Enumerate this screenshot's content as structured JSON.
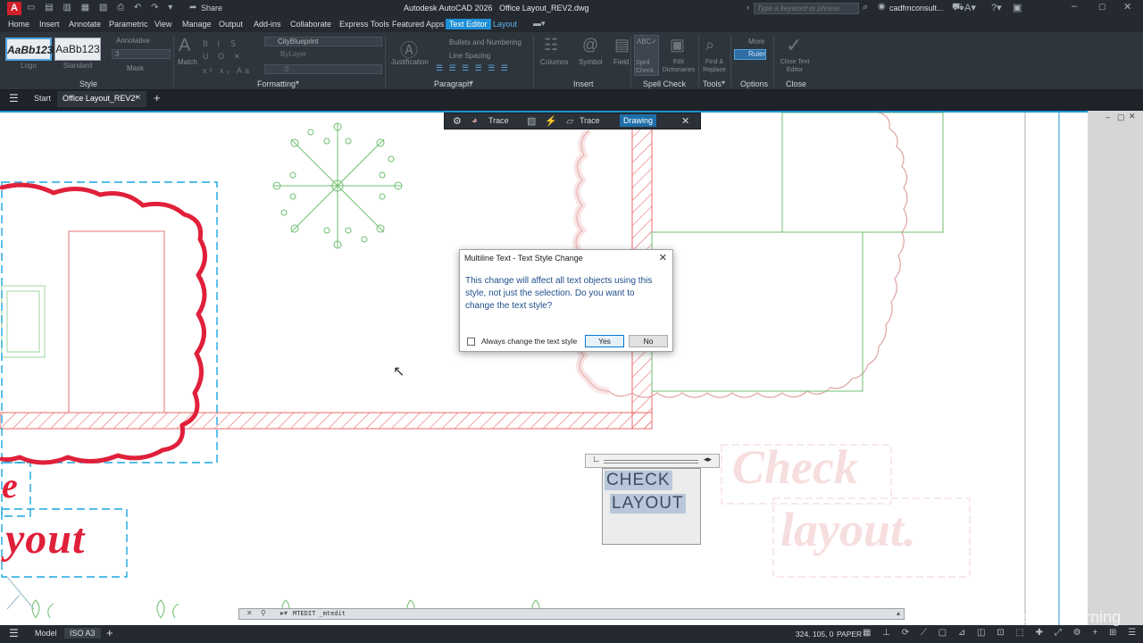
{
  "app": {
    "title": "Autodesk AutoCAD 2026   Office Layout_REV2.dwg",
    "search_placeholder": "Type a keyword or phrase",
    "user": "cadfmconsult...",
    "share_label": "Share",
    "logo_letter": "A"
  },
  "menu": {
    "items": [
      "Home",
      "Insert",
      "Annotate",
      "Parametric",
      "View",
      "Manage",
      "Output",
      "Add-ins",
      "Collaborate",
      "Express Tools",
      "Featured Apps",
      "Text Editor",
      "Layout"
    ],
    "active": "Text Editor"
  },
  "ribbon": {
    "style_swatches": [
      {
        "label": "AaBb123",
        "caption": "Logo"
      },
      {
        "label": "AaBb123",
        "caption": "Standard"
      }
    ],
    "annotative_label": "Annotative",
    "text_height_value": "3",
    "mask_label": "Mask",
    "match_label": "Match",
    "font_value": "CityBlueprint",
    "layer_value": "ByLayer",
    "color_value": "0",
    "justification_label": "Justification",
    "bullets_label": "Bullets and Numbering",
    "line_spacing_label": "Line Spacing",
    "columns_label": "Columns",
    "symbol_label": "Symbol",
    "field_label": "Field",
    "spell_check_label": "Spell Check",
    "edit_dictionaries_label": "Edit Dictionaries",
    "find_replace_label": "Find & Replace",
    "more_label": "More",
    "ruler_label": "Ruler",
    "close_editor_label": "Close Text Editor",
    "panels": [
      "Style",
      "Formatting",
      "Paragraph",
      "Insert",
      "Spell Check",
      "Tools",
      "Options",
      "Close"
    ]
  },
  "doc_tabs": {
    "start": "Start",
    "active": "Office Layout_REV2*"
  },
  "floating_toolbar": {
    "trace1": "Trace",
    "trace2": "Trace",
    "drawing": "Drawing"
  },
  "dialog": {
    "title": "Multiline Text - Text Style Change",
    "message": "This change will affect all text objects using this style, not just the selection. Do you want to change the text style?",
    "checkbox_label": "Always change the text style",
    "checkbox_checked": false,
    "yes_label": "Yes",
    "no_label": "No"
  },
  "drawing": {
    "mtext_lines": [
      "CHECK",
      "LAYOUT"
    ],
    "left_text_1": "e",
    "left_text_2": "yout",
    "ghost_text_1": "Check",
    "ghost_text_2": "layout."
  },
  "command_line": {
    "text": "MTEDIT _mtedit"
  },
  "status": {
    "tabs": [
      "Model",
      "ISO A3"
    ],
    "active_tab": "ISO A3",
    "coords": "324, 105, 0",
    "space": "PAPER"
  },
  "watermark": "Linked in Learning",
  "colors": {
    "accent": "#1e8fd6",
    "red_markup": "#e0203a",
    "cyan_dash": "#1aa6e0",
    "green_linework": "#6fbf6f",
    "hatch": "#e86a6a"
  }
}
